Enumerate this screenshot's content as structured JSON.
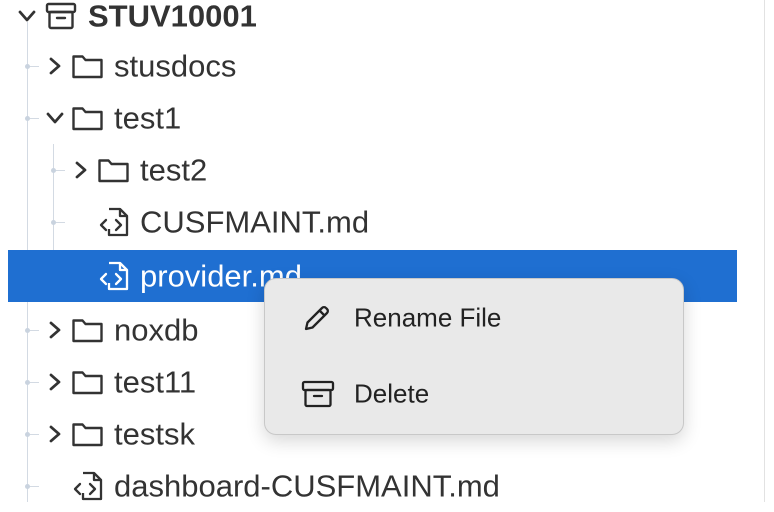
{
  "tree": {
    "root": {
      "label": "STUV10001",
      "icon": "archive-icon",
      "expanded": true
    },
    "items": [
      {
        "label": "stusdocs",
        "type": "folder",
        "expanded": false
      },
      {
        "label": "test1",
        "type": "folder",
        "expanded": true
      },
      {
        "label": "test2",
        "type": "folder",
        "expanded": false
      },
      {
        "label": "CUSFMAINT.md",
        "type": "file"
      },
      {
        "label": "provider.md",
        "type": "file",
        "selected": true
      },
      {
        "label": "noxdb",
        "type": "folder",
        "expanded": false
      },
      {
        "label": "test11",
        "type": "folder",
        "expanded": false
      },
      {
        "label": "testsk",
        "type": "folder",
        "expanded": false
      },
      {
        "label": "dashboard-CUSFMAINT.md",
        "type": "file"
      }
    ]
  },
  "context_menu": {
    "items": [
      {
        "label": "Rename File",
        "icon": "pencil-icon"
      },
      {
        "label": "Delete",
        "icon": "archive-icon"
      }
    ]
  },
  "colors": {
    "selection": "#1f6fd1",
    "text": "#333333",
    "menu_background": "#e9e9e9"
  }
}
